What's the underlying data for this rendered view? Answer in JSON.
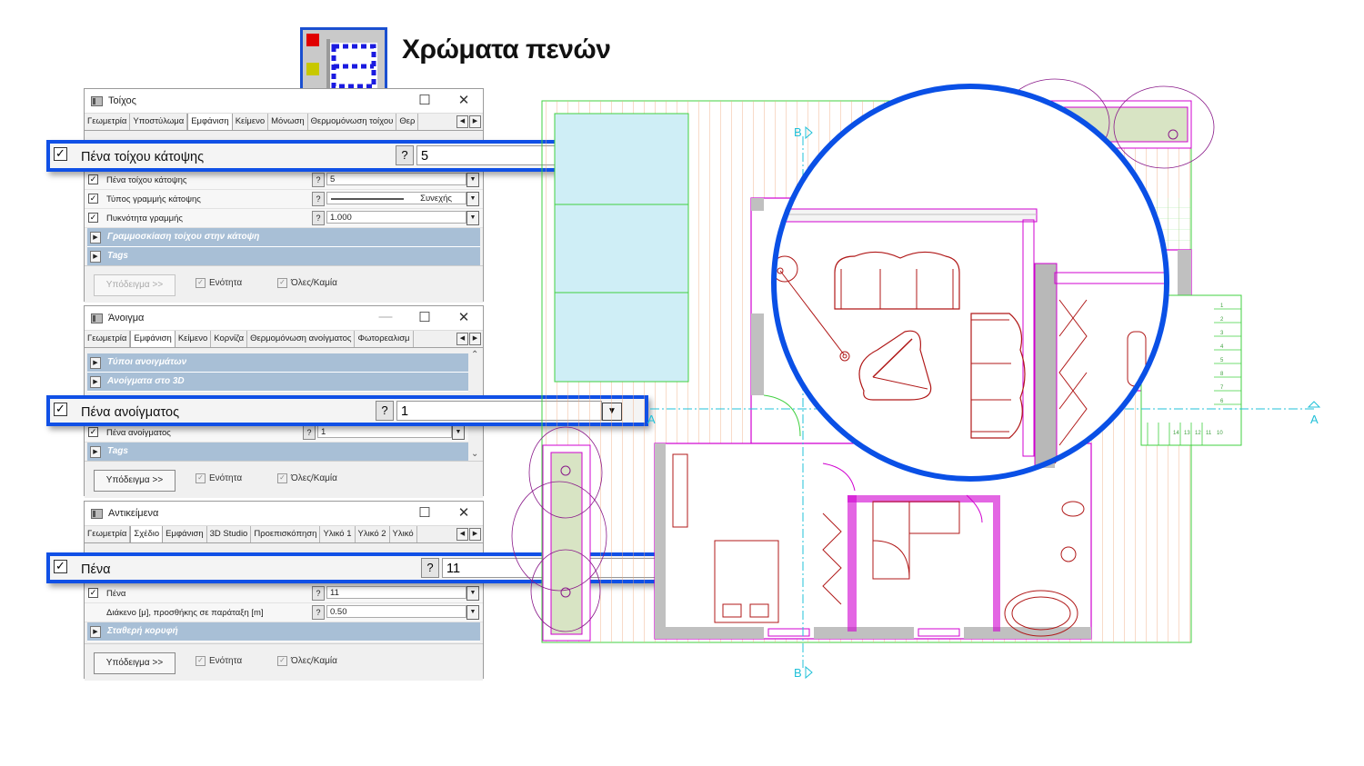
{
  "header": {
    "title": "Χρώματα πενών",
    "icon": "pen-colors-icon"
  },
  "window_wall": {
    "title": "Τοίχος",
    "tabs": [
      "Γεωμετρία",
      "Υποστύλωμα",
      "Εμφάνιση",
      "Κείμενο",
      "Μόνωση",
      "Θερμομόνωση τοίχου",
      "Θερ"
    ],
    "active_tab": "Εμφάνιση",
    "highlight": {
      "label": "Πένα τοίχου κάτοψης",
      "value": "5"
    },
    "rows": [
      {
        "label": "Πένα τοίχου κάτοψης",
        "value": "5"
      },
      {
        "label": "Τύπος γραμμής κάτοψης",
        "value": "Συνεχής"
      },
      {
        "label": "Πυκνότητα γραμμής",
        "value": "1.000"
      }
    ],
    "sections": [
      "Γραμμοσκίαση τοίχου στην κάτοψη",
      "Tags"
    ],
    "footer": {
      "sample": "Υπόδειγμα >>",
      "unit": "Ενότητα",
      "all_none": "Όλες/Καμία"
    }
  },
  "window_opening": {
    "title": "Άνοιγμα",
    "tabs": [
      "Γεωμετρία",
      "Εμφάνιση",
      "Κείμενο",
      "Κορνίζα",
      "Θερμομόνωση ανοίγματος",
      "Φωτορεαλισμ"
    ],
    "active_tab": "Εμφάνιση",
    "sections_top": [
      "Τύποι ανοιγμάτων",
      "Ανοίγματα στο 3D"
    ],
    "highlight": {
      "label": "Πένα ανοίγματος",
      "value": "1"
    },
    "rows": [
      {
        "label": "Πένα ανοίγματος",
        "value": "1"
      }
    ],
    "sections": [
      "Tags"
    ],
    "footer": {
      "sample": "Υπόδειγμα >>",
      "unit": "Ενότητα",
      "all_none": "Όλες/Καμία"
    }
  },
  "window_objects": {
    "title": "Αντικείμενα",
    "tabs": [
      "Γεωμετρία",
      "Σχέδιο",
      "Εμφάνιση",
      "3D Studio",
      "Προεπισκόπηση",
      "Υλικό 1",
      "Υλικό 2",
      "Υλικό"
    ],
    "active_tab": "Σχέδιο",
    "highlight": {
      "label": "Πένα",
      "value": "11"
    },
    "rows": [
      {
        "label": "Πένα",
        "value": "11"
      },
      {
        "label": "Διάκενο [μ], προσθήκης σε παράταξη [m]",
        "value": "0.50"
      }
    ],
    "sections": [
      "Σταθερή κορυφή"
    ],
    "footer": {
      "sample": "Υπόδειγμα >>",
      "unit": "Ενότητα",
      "all_none": "Όλες/Καμία"
    }
  },
  "drawing": {
    "section_marks": [
      "B",
      "B",
      "A",
      "A"
    ],
    "stair_numbers": [
      "1",
      "2",
      "3",
      "4",
      "5",
      "6",
      "7",
      "8",
      "9",
      "10",
      "11",
      "12",
      "13",
      "14"
    ],
    "colors": {
      "wall": "#c0c0c0",
      "pen_magenta": "#d000d0",
      "pen_red": "#b01818",
      "pen_green": "#40d040",
      "pen_cyan": "#20c0d8",
      "pen_orange": "#e89868",
      "zoom_ring": "#0a50e6"
    }
  },
  "win_controls": {
    "minimize": "—",
    "maximize": "☐",
    "close": "✕"
  },
  "ui": {
    "check": "✓",
    "question": "?",
    "dropdown": "▼",
    "tab_prev": "◀",
    "tab_next": "▶",
    "section_arrow": "▶",
    "scroll_up": "⌃",
    "scroll_down": "⌄"
  }
}
